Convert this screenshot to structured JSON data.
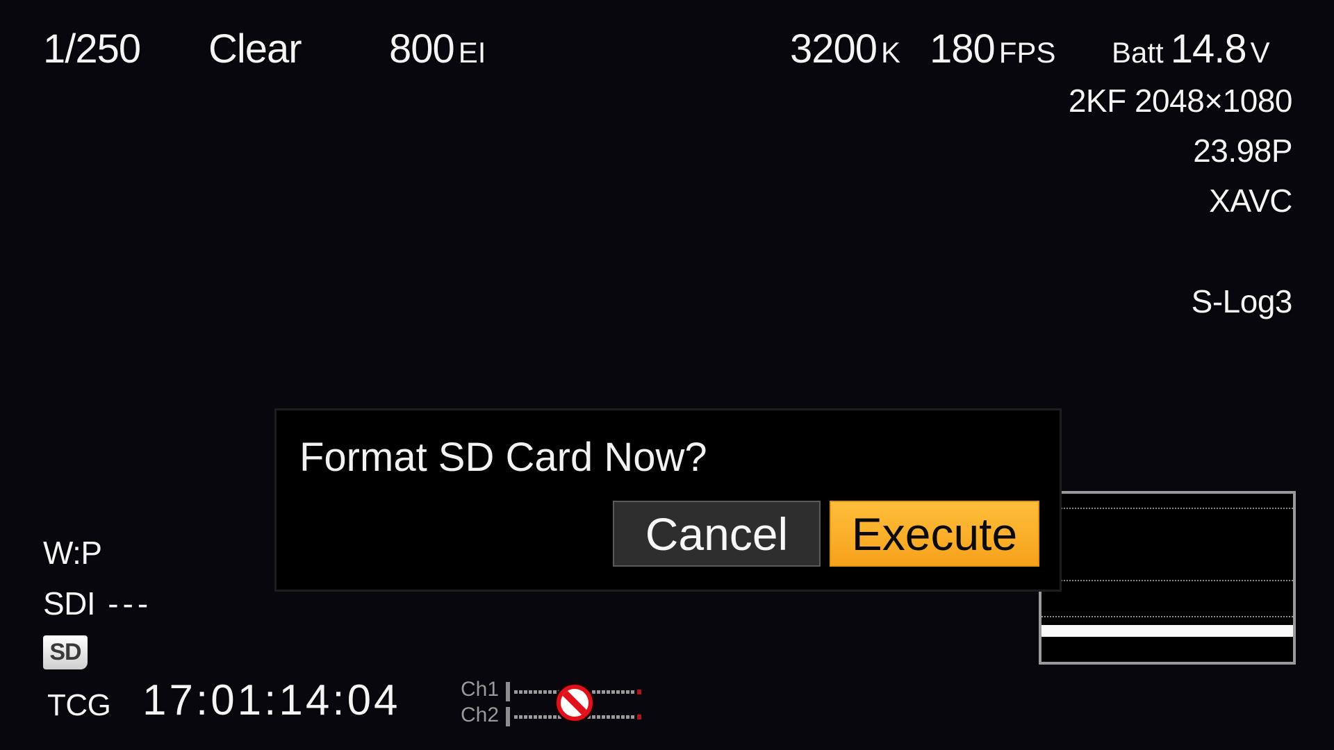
{
  "top_bar": {
    "shutter": "1/250",
    "nd_filter": "Clear",
    "iso_value": "800",
    "iso_unit": "EI",
    "white_balance_value": "3200",
    "white_balance_unit": "K",
    "frame_rate_value": "180",
    "frame_rate_unit": "FPS",
    "battery_label": "Batt",
    "battery_value": "14.8",
    "battery_unit": "V"
  },
  "right_info": {
    "resolution": "2KF 2048×1080",
    "project_rate": "23.98P",
    "codec": "XAVC",
    "gamma": "S-Log3"
  },
  "dialog": {
    "title": "Format SD Card Now?",
    "cancel_label": "Cancel",
    "execute_label": "Execute",
    "execute_color": "#f8a920",
    "cancel_color": "#2e2e2f"
  },
  "bottom_left": {
    "wp_status": "W:P",
    "sdi_label": "SDI",
    "sdi_value": "---",
    "media_badge": "SD",
    "timecode_label": "TCG",
    "timecode": "17:01:14:04"
  },
  "audio_meter": {
    "channels": [
      {
        "label": "Ch1",
        "level": 0
      },
      {
        "label": "Ch2",
        "level": 0
      }
    ],
    "status_icon": "no-entry-icon",
    "status_color": "#e0111b"
  },
  "waveform": {
    "icon": "waveform-monitor",
    "signal_level_percent": 10
  }
}
